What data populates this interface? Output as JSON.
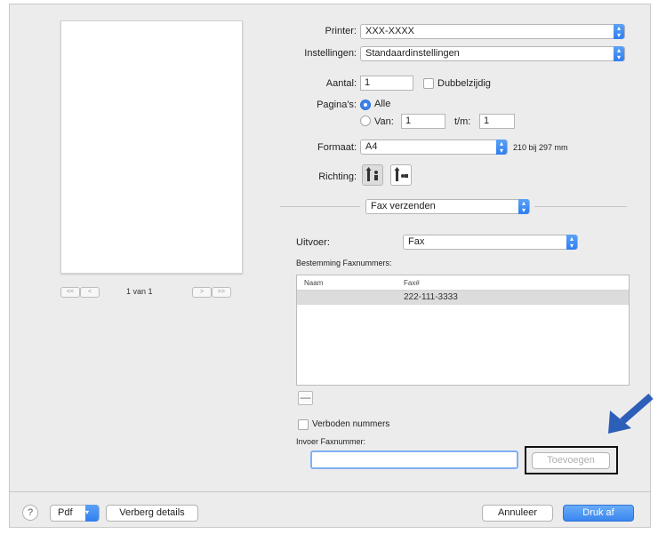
{
  "preview": {
    "page_label": "1 van 1",
    "first_label": "<<",
    "prev_label": "<",
    "next_label": ">",
    "last_label": ">>"
  },
  "settings": {
    "printer_label": "Printer:",
    "printer_value": "XXX-XXXX",
    "presets_label": "Instellingen:",
    "presets_value": "Standaardinstellingen",
    "copies_label": "Aantal:",
    "copies_value": "1",
    "duplex_label": "Dubbelzijdig",
    "pages_label": "Pagina's:",
    "pages_all_label": "Alle",
    "pages_from_label": "Van:",
    "pages_from_value": "1",
    "pages_to_label": "t/m:",
    "pages_to_value": "1",
    "paper_label": "Formaat:",
    "paper_value": "A4",
    "paper_size_text": "210 bij 297 mm",
    "orientation_label": "Richting:"
  },
  "section_popup": {
    "value": "Fax verzenden"
  },
  "fax": {
    "output_label": "Uitvoer:",
    "output_value": "Fax",
    "destination_label": "Bestemming Faxnummers:",
    "table": {
      "columns": [
        "Naam",
        "Fax#"
      ],
      "rows": [
        {
          "name": "",
          "fax": "222-111-3333"
        }
      ]
    },
    "remove_label": "—",
    "forbidden_label": "Verboden nummers",
    "input_label": "Invoer Faxnummer:",
    "input_value": "",
    "add_button": "Toevoegen"
  },
  "footer": {
    "help_label": "?",
    "pdf_label": "Pdf",
    "hide_details_label": "Verberg details",
    "cancel_label": "Annuleer",
    "print_label": "Druk af"
  },
  "colors": {
    "accent": "#3a86f0",
    "annotation_arrow": "#2d5fb8"
  }
}
